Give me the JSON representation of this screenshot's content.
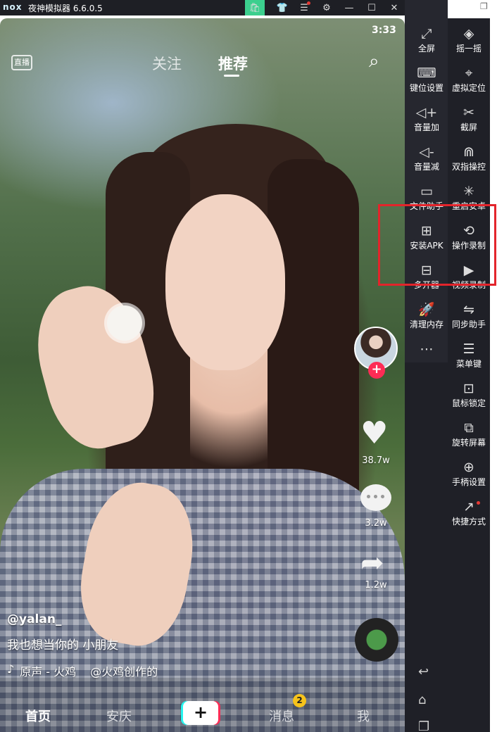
{
  "window": {
    "logo": "nox",
    "title": "夜神模拟器 6.6.0.5",
    "controls": [
      "store-icon",
      "skin-icon",
      "menu-icon",
      "settings-icon",
      "minimize-icon",
      "maximize-icon",
      "close-icon",
      "collapse-icon"
    ],
    "restore_icon": "restore-icon"
  },
  "status_bar": {
    "time": "3:33"
  },
  "app": {
    "top_tabs": {
      "live": "直播",
      "follow": "关注",
      "recommend": "推荐"
    },
    "side": {
      "likes": "38.7w",
      "comments": "3.2w",
      "shares": "1.2w"
    },
    "caption": {
      "user": "@yalan_",
      "text": "我也想当你的 小朋友",
      "music": "原声 - 火鸡",
      "music_creator": "@火鸡创作的"
    },
    "bottom_nav": {
      "home": "首页",
      "city": "安庆",
      "plus": "+",
      "messages": "消息",
      "messages_badge": "2",
      "me": "我"
    }
  },
  "toolbar_left": [
    {
      "name": "fullscreen",
      "icon": "⤢",
      "label": "全屏"
    },
    {
      "name": "key-settings",
      "icon": "⌨",
      "label": "键位设置"
    },
    {
      "name": "volume-up",
      "icon": "◁+",
      "label": "音量加"
    },
    {
      "name": "volume-down",
      "icon": "◁-",
      "label": "音量减"
    },
    {
      "name": "file-helper",
      "icon": "▭",
      "label": "文件助手"
    },
    {
      "name": "install-apk",
      "icon": "⊞",
      "label": "安装APK"
    },
    {
      "name": "multi-instance",
      "icon": "⊟",
      "label": "多开器"
    },
    {
      "name": "clean-memory",
      "icon": "🚀",
      "label": "清理内存"
    },
    {
      "name": "more",
      "icon": "⋯",
      "label": ""
    }
  ],
  "toolbar_right": [
    {
      "name": "shake",
      "icon": "◈",
      "label": "摇一摇"
    },
    {
      "name": "virtual-location",
      "icon": "⌖",
      "label": "虚拟定位"
    },
    {
      "name": "screenshot",
      "icon": "✂",
      "label": "截屏"
    },
    {
      "name": "two-finger",
      "icon": "⋒",
      "label": "双指操控"
    },
    {
      "name": "reboot",
      "icon": "✳",
      "label": "重启安卓"
    },
    {
      "name": "macro-record",
      "icon": "⟲",
      "label": "操作录制"
    },
    {
      "name": "video-record",
      "icon": "▶",
      "label": "视频录制"
    },
    {
      "name": "sync-helper",
      "icon": "⇋",
      "label": "同步助手"
    },
    {
      "name": "menu-key",
      "icon": "☰",
      "label": "菜单键"
    },
    {
      "name": "mouse-lock",
      "icon": "⊡",
      "label": "鼠标锁定"
    },
    {
      "name": "rotate-screen",
      "icon": "⧉",
      "label": "旋转屏幕"
    },
    {
      "name": "gamepad-settings",
      "icon": "⊕",
      "label": "手柄设置"
    },
    {
      "name": "shortcut",
      "icon": "↗",
      "label": "快捷方式"
    }
  ],
  "android_nav": {
    "back": "↩",
    "home": "⌂",
    "recents": "❐"
  },
  "colors": {
    "highlight": "#e3242b",
    "tiktok_red": "#fe2c55",
    "nox_green": "#3ccf8e"
  }
}
